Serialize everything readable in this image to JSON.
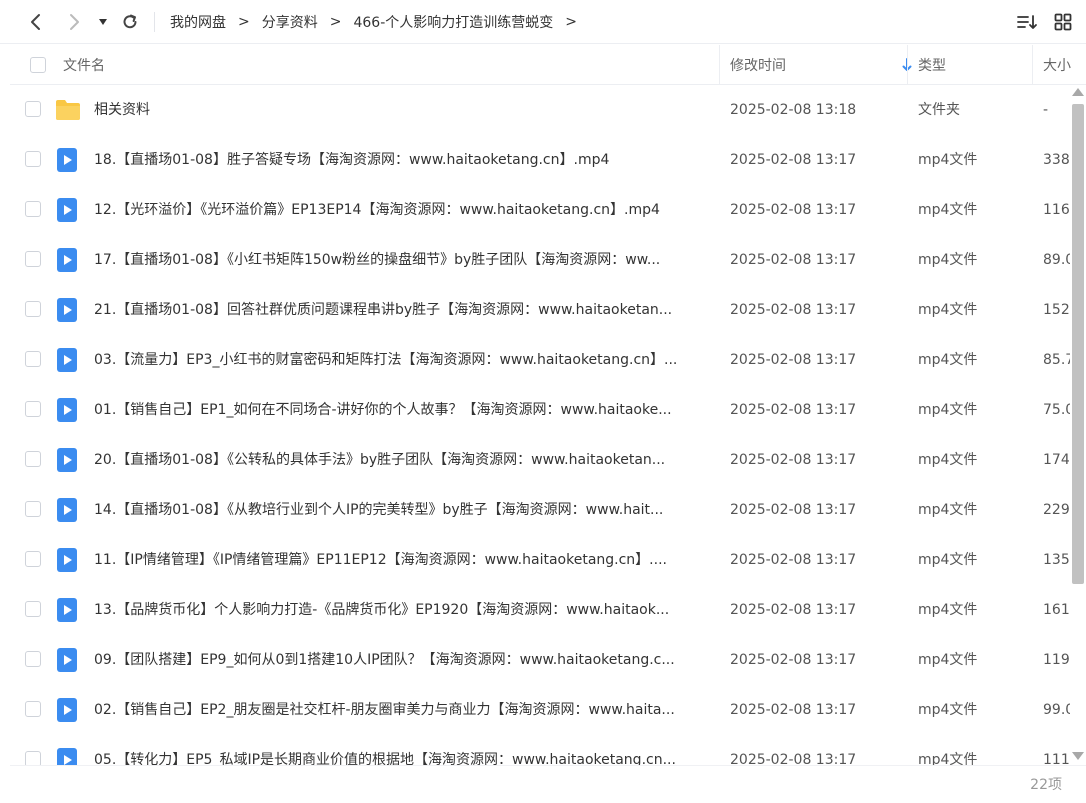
{
  "toolbar": {
    "back_icon": "chevron-left-icon",
    "forward_icon": "chevron-right-icon",
    "history_icon": "caret-down-icon",
    "refresh_icon": "refresh-icon",
    "sort_icon": "sort-list-icon",
    "view_icon": "grid-view-icon"
  },
  "breadcrumb": [
    {
      "label": "我的网盘"
    },
    {
      "label": "分享资料"
    },
    {
      "label": "466-个人影响力打造训练营蜕变"
    }
  ],
  "breadcrumb_sep": ">",
  "columns": {
    "name": "文件名",
    "time": "修改时间",
    "type": "类型",
    "size": "大小"
  },
  "sort_indicator_color": "#3b8cf0",
  "files": [
    {
      "icon": "folder-icon",
      "name": "相关资料",
      "time": "2025-02-08 13:18",
      "type": "文件夹",
      "size": "-"
    },
    {
      "icon": "video-file-icon",
      "name": "18.【直播场01-08】胜子答疑专场【海淘资源网：www.haitaoketang.cn】.mp4",
      "time": "2025-02-08 13:17",
      "type": "mp4文件",
      "size": "338"
    },
    {
      "icon": "video-file-icon",
      "name": "12.【光环溢价】《光环溢价篇》EP13EP14【海淘资源网：www.haitaoketang.cn】.mp4",
      "time": "2025-02-08 13:17",
      "type": "mp4文件",
      "size": "116"
    },
    {
      "icon": "video-file-icon",
      "name": "17.【直播场01-08】《小红书矩阵150w粉丝的操盘细节》by胜子团队【海淘资源网：ww...",
      "time": "2025-02-08 13:17",
      "type": "mp4文件",
      "size": "89.0"
    },
    {
      "icon": "video-file-icon",
      "name": "21.【直播场01-08】回答社群优质问题课程串讲by胜子【海淘资源网：www.haitaoketan...",
      "time": "2025-02-08 13:17",
      "type": "mp4文件",
      "size": "152"
    },
    {
      "icon": "video-file-icon",
      "name": "03.【流量力】EP3_小红书的财富密码和矩阵打法【海淘资源网：www.haitaoketang.cn】...",
      "time": "2025-02-08 13:17",
      "type": "mp4文件",
      "size": "85.7"
    },
    {
      "icon": "video-file-icon",
      "name": "01.【销售自己】EP1_如何在不同场合-讲好你的个人故事？【海淘资源网：www.haitaoke...",
      "time": "2025-02-08 13:17",
      "type": "mp4文件",
      "size": "75.0"
    },
    {
      "icon": "video-file-icon",
      "name": "20.【直播场01-08】《公转私的具体手法》by胜子团队【海淘资源网：www.haitaoketan...",
      "time": "2025-02-08 13:17",
      "type": "mp4文件",
      "size": "174"
    },
    {
      "icon": "video-file-icon",
      "name": "14.【直播场01-08】《从教培行业到个人IP的完美转型》by胜子【海淘资源网：www.hait...",
      "time": "2025-02-08 13:17",
      "type": "mp4文件",
      "size": "229"
    },
    {
      "icon": "video-file-icon",
      "name": "11.【IP情绪管理】《IP情绪管理篇》EP11EP12【海淘资源网：www.haitaoketang.cn】....",
      "time": "2025-02-08 13:17",
      "type": "mp4文件",
      "size": "135"
    },
    {
      "icon": "video-file-icon",
      "name": "13.【品牌货币化】个人影响力打造-《品牌货币化》EP1920【海淘资源网：www.haitaok...",
      "time": "2025-02-08 13:17",
      "type": "mp4文件",
      "size": "161"
    },
    {
      "icon": "video-file-icon",
      "name": "09.【团队搭建】EP9_如何从0到1搭建10人IP团队？【海淘资源网：www.haitaoketang.c...",
      "time": "2025-02-08 13:17",
      "type": "mp4文件",
      "size": "119"
    },
    {
      "icon": "video-file-icon",
      "name": "02.【销售自己】EP2_朋友圈是社交杠杆-朋友圈审美力与商业力【海淘资源网：www.haita...",
      "time": "2025-02-08 13:17",
      "type": "mp4文件",
      "size": "99.0"
    },
    {
      "icon": "video-file-icon",
      "name": "05.【转化力】EP5_私域IP是长期商业价值的根据地【海淘资源网：www.haitaoketang.cn...",
      "time": "2025-02-08 13:17",
      "type": "mp4文件",
      "size": "111"
    }
  ],
  "footer": {
    "count": "22项"
  },
  "colors": {
    "folder": "#f9c744",
    "video": "#3b8cf0"
  }
}
